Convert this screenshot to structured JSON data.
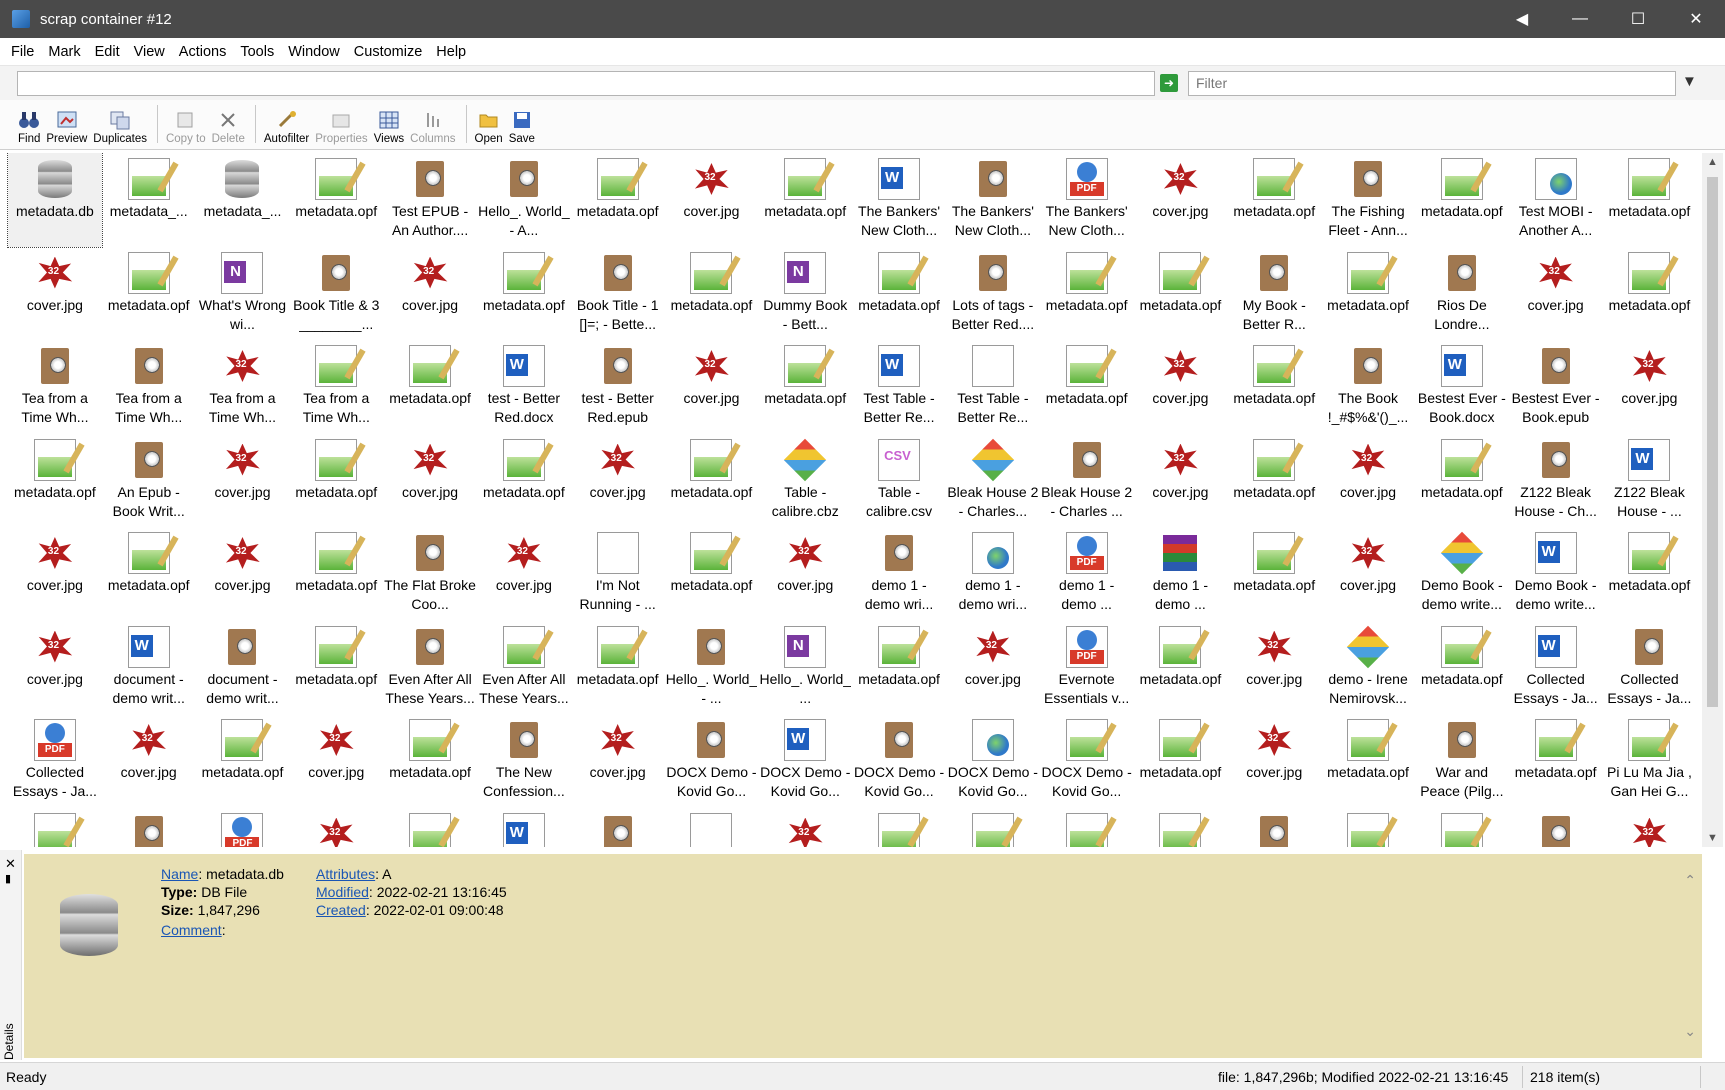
{
  "window": {
    "title": "scrap container #12"
  },
  "menu": [
    "File",
    "Mark",
    "Edit",
    "View",
    "Actions",
    "Tools",
    "Window",
    "Customize",
    "Help"
  ],
  "address": {
    "value": "",
    "filter_placeholder": "Filter"
  },
  "toolbar": [
    {
      "label": "Find",
      "icon": "binoculars-icon",
      "enabled": true
    },
    {
      "label": "Preview",
      "icon": "preview-icon",
      "enabled": true
    },
    {
      "label": "Duplicates",
      "icon": "duplicates-icon",
      "enabled": true
    },
    {
      "label": "Copy to",
      "icon": "copy-to-icon",
      "enabled": false
    },
    {
      "label": "Delete",
      "icon": "delete-icon",
      "enabled": false
    },
    {
      "label": "Autofilter",
      "icon": "autofilter-icon",
      "enabled": true
    },
    {
      "label": "Properties",
      "icon": "properties-icon",
      "enabled": false
    },
    {
      "label": "Views",
      "icon": "views-icon",
      "enabled": true
    },
    {
      "label": "Columns",
      "icon": "columns-icon",
      "enabled": false
    },
    {
      "label": "Open",
      "icon": "folder-open-icon",
      "enabled": true
    },
    {
      "label": "Save",
      "icon": "save-icon",
      "enabled": true
    }
  ],
  "files": [
    {
      "name": "metadata.db",
      "type": "db"
    },
    {
      "name": "metadata_...",
      "type": "opf"
    },
    {
      "name": "metadata_...",
      "type": "db"
    },
    {
      "name": "metadata.opf",
      "type": "opf"
    },
    {
      "name": "Test EPUB - An Author....",
      "type": "epub"
    },
    {
      "name": "Hello_. World_ - A...",
      "type": "epub"
    },
    {
      "name": "metadata.opf",
      "type": "opf"
    },
    {
      "name": "cover.jpg",
      "type": "jpg"
    },
    {
      "name": "metadata.opf",
      "type": "opf"
    },
    {
      "name": "The Bankers' New Cloth...",
      "type": "doc"
    },
    {
      "name": "The Bankers' New Cloth...",
      "type": "epub"
    },
    {
      "name": "The Bankers' New Cloth...",
      "type": "pdf"
    },
    {
      "name": "cover.jpg",
      "type": "jpg"
    },
    {
      "name": "metadata.opf",
      "type": "opf"
    },
    {
      "name": "The Fishing Fleet - Ann...",
      "type": "epub"
    },
    {
      "name": "metadata.opf",
      "type": "opf"
    },
    {
      "name": "Test MOBI - Another A...",
      "type": "mobi"
    },
    {
      "name": "metadata.opf",
      "type": "opf"
    },
    {
      "name": "cover.jpg",
      "type": "jpg"
    },
    {
      "name": "metadata.opf",
      "type": "opf"
    },
    {
      "name": "What's Wrong wi...",
      "type": "one"
    },
    {
      "name": "Book Title & 3 ________...",
      "type": "epub"
    },
    {
      "name": "cover.jpg",
      "type": "jpg"
    },
    {
      "name": "metadata.opf",
      "type": "opf"
    },
    {
      "name": "Book Title - 1 []=; - Bette...",
      "type": "epub"
    },
    {
      "name": "metadata.opf",
      "type": "opf"
    },
    {
      "name": "Dummy Book - Bett...",
      "type": "one"
    },
    {
      "name": "metadata.opf",
      "type": "opf"
    },
    {
      "name": "Lots of tags - Better Red....",
      "type": "epub"
    },
    {
      "name": "metadata.opf",
      "type": "opf"
    },
    {
      "name": "metadata.opf",
      "type": "opf"
    },
    {
      "name": "My Book - Better R...",
      "type": "epub"
    },
    {
      "name": "metadata.opf",
      "type": "opf"
    },
    {
      "name": "Rios De Londre...",
      "type": "epub"
    },
    {
      "name": "cover.jpg",
      "type": "jpg"
    },
    {
      "name": "metadata.opf",
      "type": "opf"
    },
    {
      "name": "Tea from a Time Wh...",
      "type": "epub"
    },
    {
      "name": "Tea from a Time Wh...",
      "type": "epub"
    },
    {
      "name": "Tea from a Time Wh...",
      "type": "jpg"
    },
    {
      "name": "Tea from a Time Wh...",
      "type": "opf"
    },
    {
      "name": "metadata.opf",
      "type": "opf"
    },
    {
      "name": "test - Better Red.docx",
      "type": "doc"
    },
    {
      "name": "test - Better Red.epub",
      "type": "epub"
    },
    {
      "name": "cover.jpg",
      "type": "jpg"
    },
    {
      "name": "metadata.opf",
      "type": "opf"
    },
    {
      "name": "Test Table - Better Re...",
      "type": "doc"
    },
    {
      "name": "Test Table - Better Re...",
      "type": "blank"
    },
    {
      "name": "metadata.opf",
      "type": "opf"
    },
    {
      "name": "cover.jpg",
      "type": "jpg"
    },
    {
      "name": "metadata.opf",
      "type": "opf"
    },
    {
      "name": "The Book !_#$%&'()_...",
      "type": "epub"
    },
    {
      "name": "Bestest Ever - Book.docx",
      "type": "doc"
    },
    {
      "name": "Bestest Ever - Book.epub",
      "type": "epub"
    },
    {
      "name": "cover.jpg",
      "type": "jpg"
    },
    {
      "name": "metadata.opf",
      "type": "opf"
    },
    {
      "name": "An Epub - Book Writ...",
      "type": "epub"
    },
    {
      "name": "cover.jpg",
      "type": "jpg"
    },
    {
      "name": "metadata.opf",
      "type": "opf"
    },
    {
      "name": "cover.jpg",
      "type": "jpg"
    },
    {
      "name": "metadata.opf",
      "type": "opf"
    },
    {
      "name": "cover.jpg",
      "type": "jpg"
    },
    {
      "name": "metadata.opf",
      "type": "opf"
    },
    {
      "name": "Table - calibre.cbz",
      "type": "cbz"
    },
    {
      "name": "Table - calibre.csv",
      "type": "csv"
    },
    {
      "name": "Bleak House 2 - Charles...",
      "type": "cbz"
    },
    {
      "name": "Bleak House 2 - Charles ...",
      "type": "epub"
    },
    {
      "name": "cover.jpg",
      "type": "jpg"
    },
    {
      "name": "metadata.opf",
      "type": "opf"
    },
    {
      "name": "cover.jpg",
      "type": "jpg"
    },
    {
      "name": "metadata.opf",
      "type": "opf"
    },
    {
      "name": "Z122 Bleak House - Ch...",
      "type": "epub"
    },
    {
      "name": "Z122 Bleak House - ...",
      "type": "doc"
    },
    {
      "name": "cover.jpg",
      "type": "jpg"
    },
    {
      "name": "metadata.opf",
      "type": "opf"
    },
    {
      "name": "cover.jpg",
      "type": "jpg"
    },
    {
      "name": "metadata.opf",
      "type": "opf"
    },
    {
      "name": "The Flat Broke Coo...",
      "type": "epub"
    },
    {
      "name": "cover.jpg",
      "type": "jpg"
    },
    {
      "name": "I'm Not Running - ...",
      "type": "blank"
    },
    {
      "name": "metadata.opf",
      "type": "opf"
    },
    {
      "name": "cover.jpg",
      "type": "jpg"
    },
    {
      "name": "demo 1 - demo wri...",
      "type": "epub"
    },
    {
      "name": "demo 1 - demo wri...",
      "type": "mobi"
    },
    {
      "name": "demo 1 - demo ...",
      "type": "pdf"
    },
    {
      "name": "demo 1 - demo ...",
      "type": "rar"
    },
    {
      "name": "metadata.opf",
      "type": "opf"
    },
    {
      "name": "cover.jpg",
      "type": "jpg"
    },
    {
      "name": "Demo Book - demo write...",
      "type": "cbz"
    },
    {
      "name": "Demo Book - demo write...",
      "type": "doc"
    },
    {
      "name": "metadata.opf",
      "type": "opf"
    },
    {
      "name": "cover.jpg",
      "type": "jpg"
    },
    {
      "name": "document - demo writ...",
      "type": "doc"
    },
    {
      "name": "document - demo writ...",
      "type": "epub"
    },
    {
      "name": "metadata.opf",
      "type": "opf"
    },
    {
      "name": "Even After All These Years...",
      "type": "epub"
    },
    {
      "name": "Even After All These Years...",
      "type": "opf"
    },
    {
      "name": "metadata.opf",
      "type": "opf"
    },
    {
      "name": "Hello_. World_ - ...",
      "type": "epub"
    },
    {
      "name": "Hello_. World_ ...",
      "type": "one"
    },
    {
      "name": "metadata.opf",
      "type": "opf"
    },
    {
      "name": "cover.jpg",
      "type": "jpg"
    },
    {
      "name": "Evernote Essentials v...",
      "type": "pdf"
    },
    {
      "name": "metadata.opf",
      "type": "opf"
    },
    {
      "name": "cover.jpg",
      "type": "jpg"
    },
    {
      "name": "demo - Irene Nemirovsk...",
      "type": "cbz"
    },
    {
      "name": "metadata.opf",
      "type": "opf"
    },
    {
      "name": "Collected Essays - Ja...",
      "type": "doc"
    },
    {
      "name": "Collected Essays - Ja...",
      "type": "epub"
    },
    {
      "name": "Collected Essays - Ja...",
      "type": "pdf"
    },
    {
      "name": "cover.jpg",
      "type": "jpg"
    },
    {
      "name": "metadata.opf",
      "type": "opf"
    },
    {
      "name": "cover.jpg",
      "type": "jpg"
    },
    {
      "name": "metadata.opf",
      "type": "opf"
    },
    {
      "name": "The New Confession...",
      "type": "epub"
    },
    {
      "name": "cover.jpg",
      "type": "jpg"
    },
    {
      "name": "DOCX Demo - Kovid Go...",
      "type": "epub"
    },
    {
      "name": "DOCX Demo - Kovid Go...",
      "type": "doc"
    },
    {
      "name": "DOCX Demo - Kovid Go...",
      "type": "epub"
    },
    {
      "name": "DOCX Demo - Kovid Go...",
      "type": "mobi"
    },
    {
      "name": "DOCX Demo - Kovid Go...",
      "type": "opf"
    },
    {
      "name": "metadata.opf",
      "type": "opf"
    },
    {
      "name": "cover.jpg",
      "type": "jpg"
    },
    {
      "name": "metadata.opf",
      "type": "opf"
    },
    {
      "name": "War and Peace (Pilg...",
      "type": "epub"
    },
    {
      "name": "metadata.opf",
      "type": "opf"
    },
    {
      "name": "Pi Lu Ma Jia , Gan Hei G...",
      "type": "opf"
    },
    {
      "name": "",
      "type": "opf"
    },
    {
      "name": "",
      "type": "epub"
    },
    {
      "name": "",
      "type": "pdf"
    },
    {
      "name": "",
      "type": "jpg"
    },
    {
      "name": "",
      "type": "opf"
    },
    {
      "name": "",
      "type": "doc"
    },
    {
      "name": "",
      "type": "epub"
    },
    {
      "name": "",
      "type": "blank"
    },
    {
      "name": "",
      "type": "jpg"
    },
    {
      "name": "",
      "type": "opf"
    },
    {
      "name": "",
      "type": "opf"
    },
    {
      "name": "",
      "type": "opf"
    },
    {
      "name": "",
      "type": "opf"
    },
    {
      "name": "",
      "type": "epub"
    },
    {
      "name": "",
      "type": "opf"
    },
    {
      "name": "",
      "type": "opf"
    },
    {
      "name": "",
      "type": "epub"
    },
    {
      "name": "",
      "type": "jpg"
    }
  ],
  "details": {
    "name_label": "Name",
    "name_value": ": metadata.db",
    "type_label": "Type:",
    "type_value": " DB File",
    "size_label": "Size:",
    "size_value": " 1,847,296",
    "comment_label": "Comment",
    "comment_suffix": ":",
    "attributes_label": "Attributes",
    "attributes_value": ": A",
    "modified_label": "Modified",
    "modified_value": ": 2022-02-21 13:16:45",
    "created_label": "Created",
    "created_value": ": 2022-02-01 09:00:48",
    "panel_label": "Details"
  },
  "status": {
    "left": "Ready",
    "file_info": "file: 1,847,296b; Modified 2022-02-21 13:16:45",
    "count": "218 item(s)"
  }
}
